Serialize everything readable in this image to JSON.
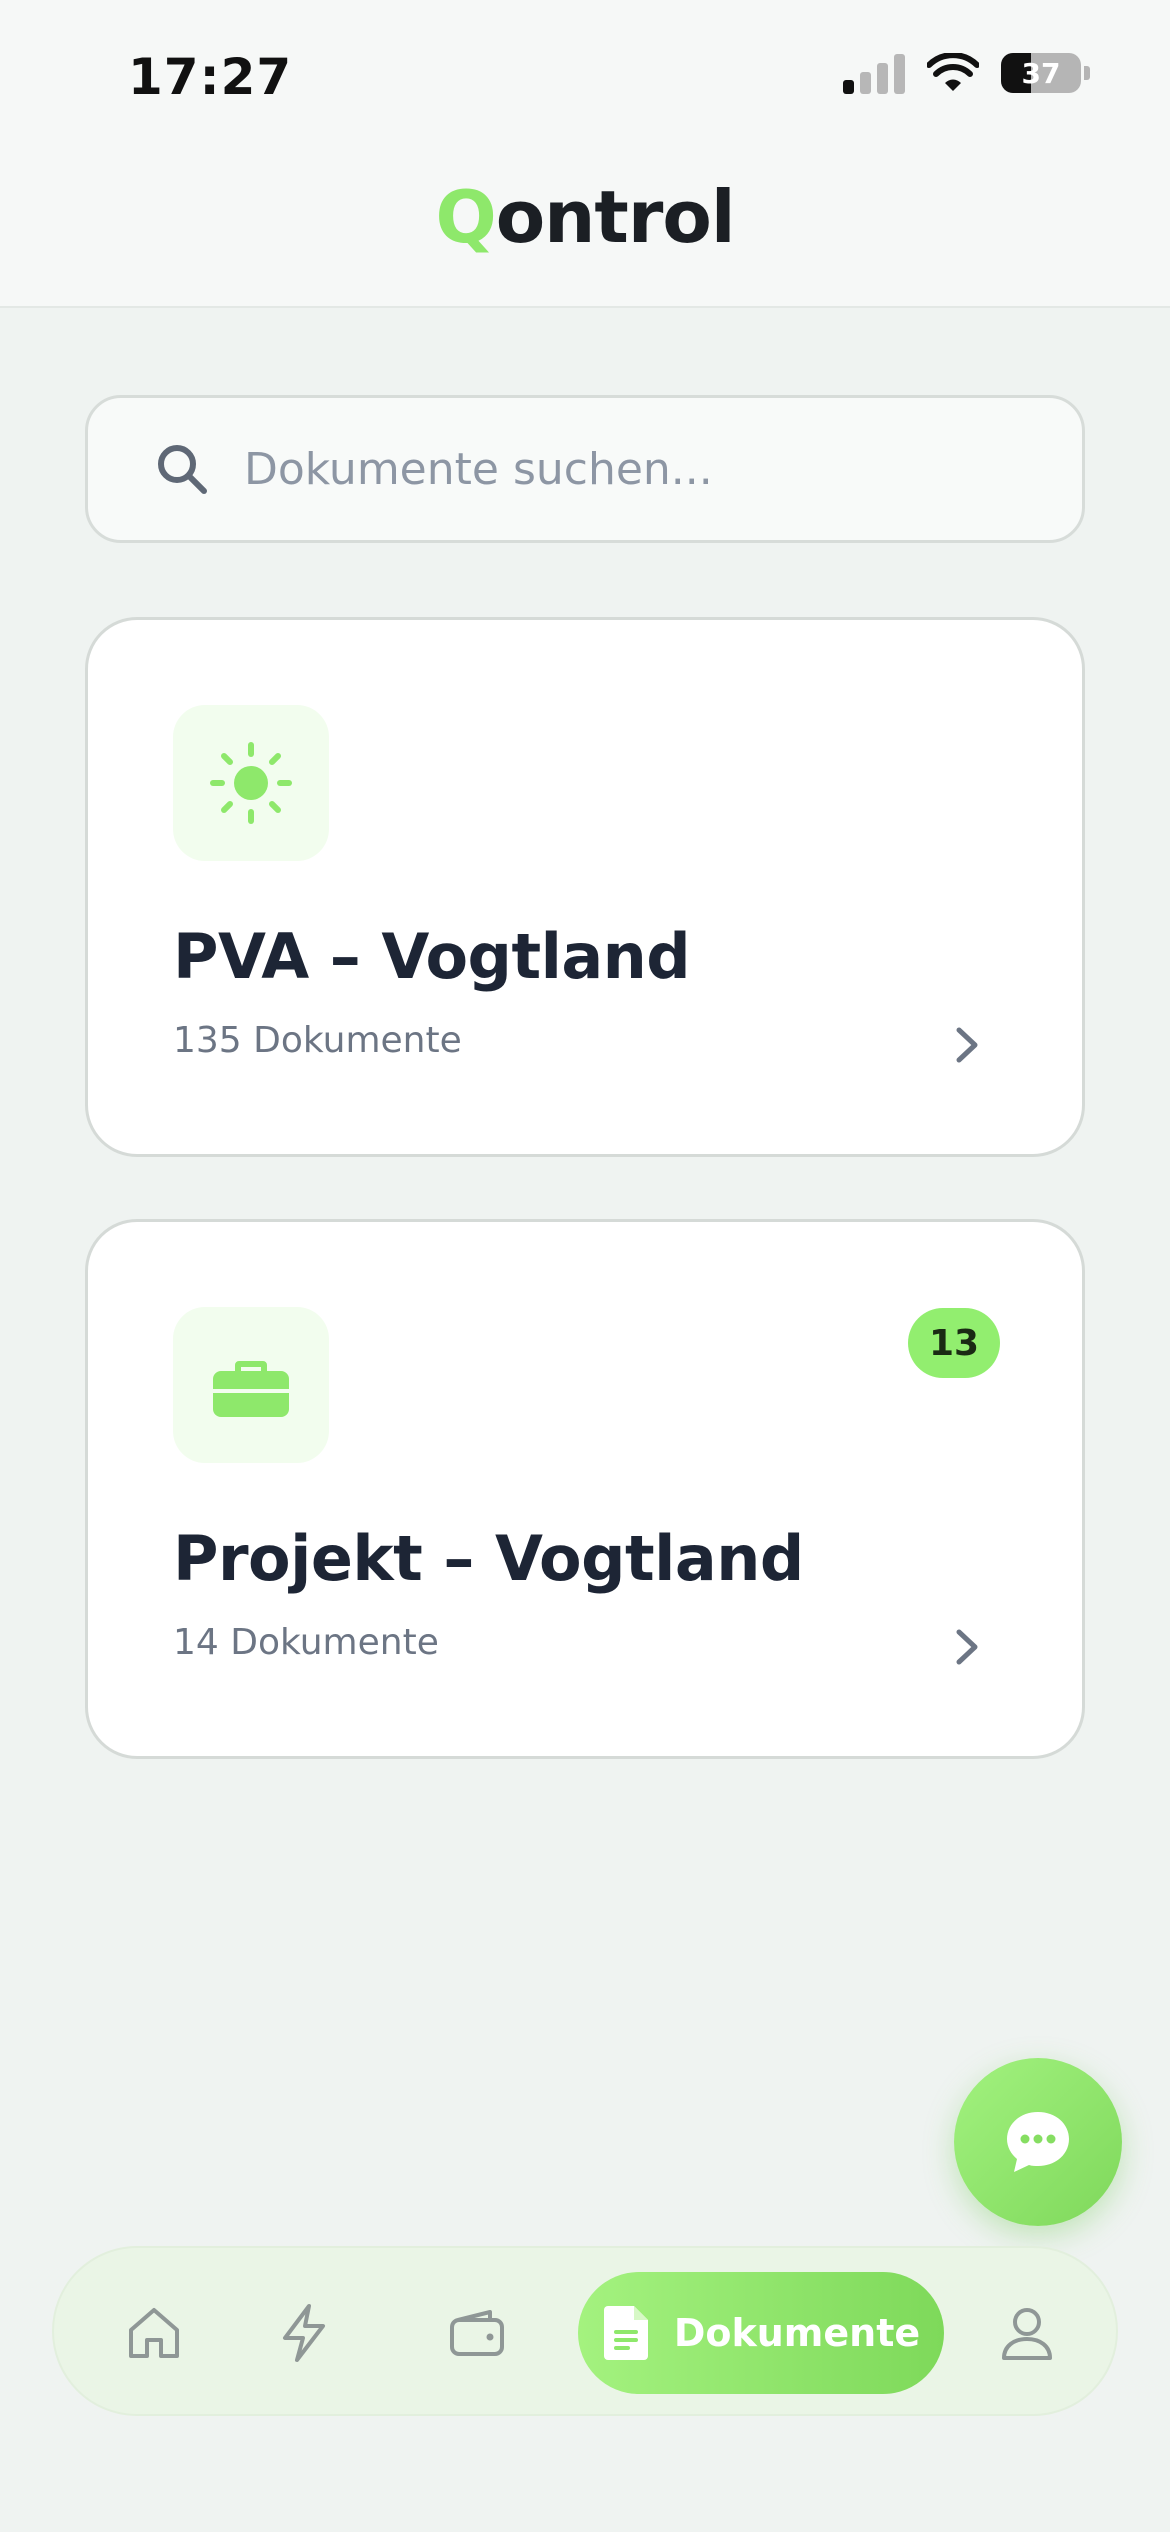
{
  "status_bar": {
    "time": "17:27",
    "battery": "37",
    "battery_level_percent": 37
  },
  "header": {
    "brand_first": "Q",
    "brand_rest": "ontrol",
    "brand_color": "#8ee86b"
  },
  "search": {
    "placeholder": "Dokumente suchen..."
  },
  "folders": [
    {
      "icon": "sun-icon",
      "title": "PVA – Vogtland",
      "count": "135 Dokumente",
      "badge": ""
    },
    {
      "icon": "briefcase-icon",
      "title": "Projekt – Vogtland",
      "count": "14 Dokumente",
      "badge": "13"
    }
  ],
  "chat": {
    "icon": "chat-bubble-icon"
  },
  "bottom_nav": {
    "items": [
      {
        "icon": "home-icon"
      },
      {
        "icon": "lightning-icon"
      },
      {
        "icon": "wallet-icon"
      },
      {
        "icon": "document-icon",
        "label": "Dokumente",
        "active": true
      },
      {
        "icon": "user-icon"
      }
    ]
  },
  "accent_color": "#92ee6f"
}
